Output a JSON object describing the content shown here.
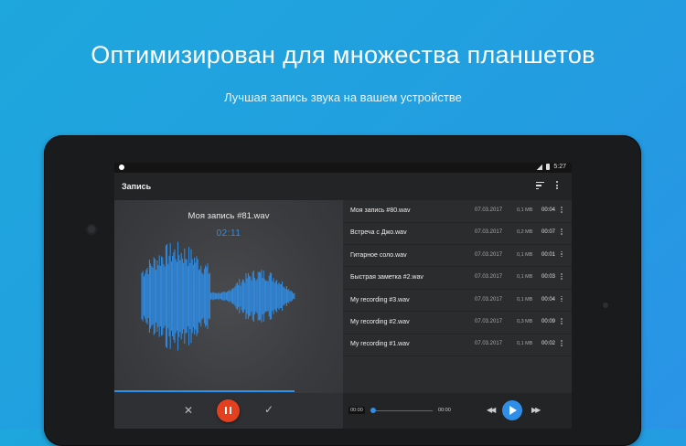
{
  "hero": {
    "headline": "Оптимизирован для множества планшетов",
    "subheadline": "Лучшая запись звука на вашем устройстве"
  },
  "status_bar": {
    "time": "5:27"
  },
  "app_bar": {
    "title": "Запись",
    "icons": [
      "sort-icon",
      "more-vert-icon"
    ]
  },
  "recorder": {
    "file_name": "Моя запись #81.wav",
    "elapsed": "02:11",
    "controls": {
      "discard": "✕",
      "save": "✓"
    }
  },
  "recordings": [
    {
      "name": "Моя запись #80.wav",
      "date": "07.03.2017",
      "size": "0,1 MB",
      "duration": "00:04"
    },
    {
      "name": "Встреча с Джо.wav",
      "date": "07.03.2017",
      "size": "0,2 MB",
      "duration": "00:07"
    },
    {
      "name": "Гитарное соло.wav",
      "date": "07.03.2017",
      "size": "0,1 MB",
      "duration": "00:01"
    },
    {
      "name": "Быстрая заметка #2.wav",
      "date": "07.03.2017",
      "size": "0,1 MB",
      "duration": "00:03"
    },
    {
      "name": "My recording #3.wav",
      "date": "07.03.2017",
      "size": "0,1 MB",
      "duration": "00:04"
    },
    {
      "name": "My recording #2.wav",
      "date": "07.03.2017",
      "size": "0,3 MB",
      "duration": "00:09"
    },
    {
      "name": "My recording #1.wav",
      "date": "07.03.2017",
      "size": "0,1 MB",
      "duration": "00:02"
    }
  ],
  "player": {
    "position": "00:00",
    "duration": "00:00",
    "rewind": "◀◀",
    "forward": "▶▶"
  },
  "colors": {
    "accent": "#2f8ee8",
    "record": "#e2401f",
    "background": "#229ee0"
  }
}
